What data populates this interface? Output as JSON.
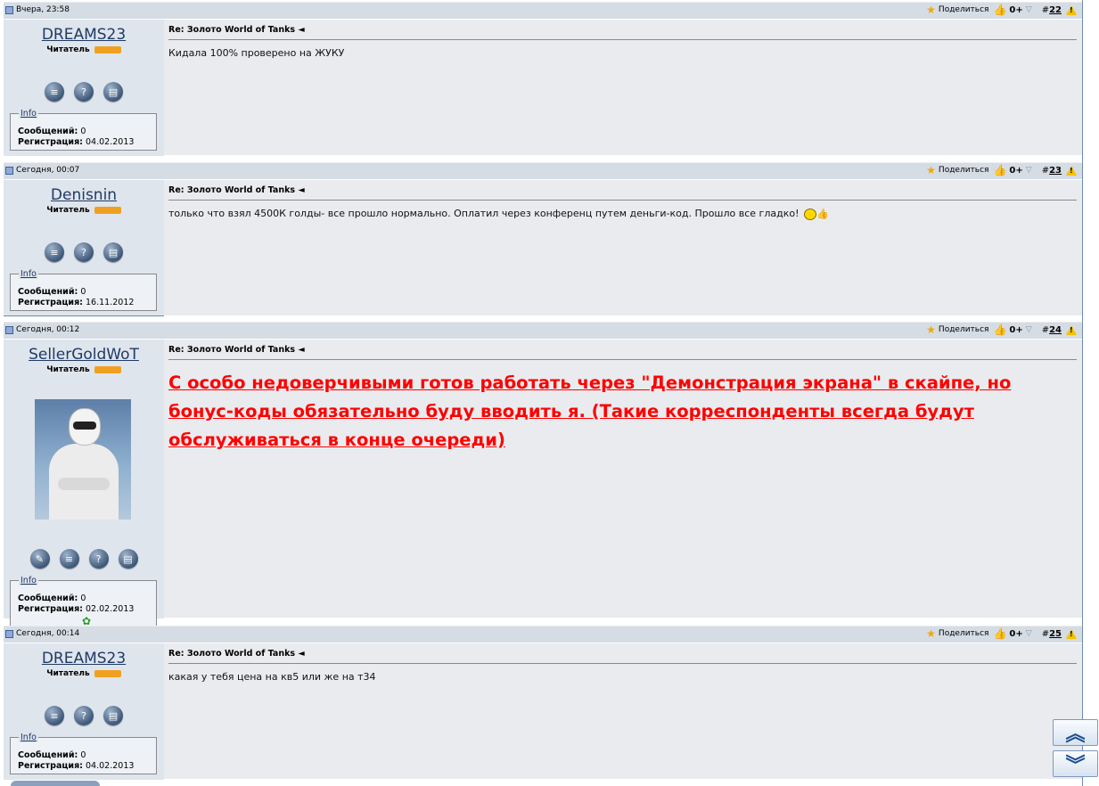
{
  "icons": [
    "doc-icon",
    "star-icon",
    "thumbs-up-icon",
    "rep-down-icon",
    "warning-icon",
    "quote-icon",
    "reply-icon",
    "multiquote-icon",
    "edit-icon",
    "smiley-icon",
    "clover-icon",
    "scroll-up-icon",
    "scroll-down-icon"
  ],
  "colors": {
    "header_bg": "#d5dce4",
    "post_bg": "#e9ebee",
    "sidebar_bg": "#dfe5ec",
    "username": "#1f3a66",
    "emphasis": "#ff0000"
  },
  "common": {
    "share_label": "Поделиться",
    "rep_value": "0+",
    "subject": "Re: Золото World of Tanks ◄",
    "rank": "Читатель",
    "info_label": "Info",
    "posts_label": "Сообщений:",
    "reg_label": "Регистрация:"
  },
  "posts": [
    {
      "date": "Вчера, 23:58",
      "number": "22",
      "username": "DREAMS23",
      "posts_count": "0",
      "reg_date": "04.02.2013",
      "message": "Кидала 100% проверено на ЖУКУ"
    },
    {
      "date": "Сегодня, 00:07",
      "number": "23",
      "username": "Denisnin",
      "posts_count": "0",
      "reg_date": "16.11.2012",
      "message": "только что взял 4500К голды- все прошло нормально. Оплатил через конференц путем деньги-код. Прошло все гладко!"
    },
    {
      "date": "Сегодня, 00:12",
      "number": "24",
      "username": "SellerGoldWoT",
      "posts_count": "0",
      "reg_date": "02.02.2013",
      "message": "С особо недоверчивыми готов работать через \"Демонстрация экрана\" в скайпе, но бонус-коды обязательно буду вводить я. (Такие корреспонденты всегда будут обслуживаться в конце очереди)"
    },
    {
      "date": "Сегодня, 00:14",
      "number": "25",
      "username": "DREAMS23",
      "posts_count": "0",
      "reg_date": "04.02.2013",
      "message": "какая у тебя цена на кв5 или же на т34"
    }
  ]
}
